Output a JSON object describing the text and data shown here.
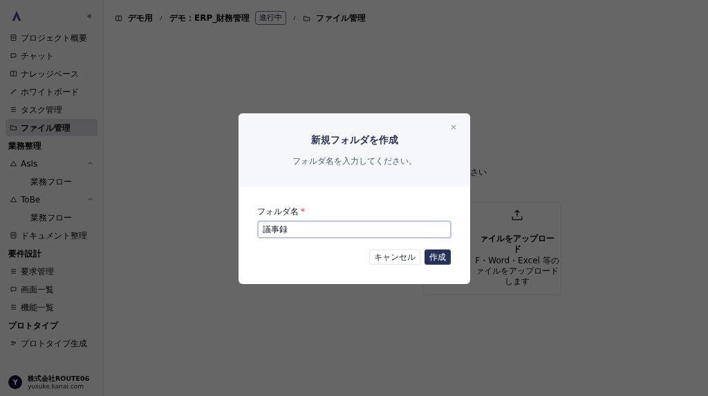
{
  "sidebar": {
    "collapse_icon": "«",
    "items": [
      {
        "kind": "item",
        "label": "プロジェクト概要",
        "selected": false
      },
      {
        "kind": "item",
        "label": "チャット",
        "selected": false
      },
      {
        "kind": "item",
        "label": "ナレッジベース",
        "selected": false
      },
      {
        "kind": "item",
        "label": "ホワイトボード",
        "selected": false
      },
      {
        "kind": "item",
        "label": "タスク管理",
        "selected": false
      },
      {
        "kind": "item",
        "label": "ファイル管理",
        "selected": true
      },
      {
        "kind": "section",
        "label": "業務整理"
      },
      {
        "kind": "group",
        "label": "AsIs",
        "expanded": true,
        "children": [
          {
            "label": "業務フロー"
          }
        ]
      },
      {
        "kind": "group",
        "label": "ToBe",
        "expanded": true,
        "children": [
          {
            "label": "業務フロー"
          }
        ]
      },
      {
        "kind": "item",
        "label": "ドキュメント整理",
        "selected": false
      },
      {
        "kind": "section",
        "label": "要件設計"
      },
      {
        "kind": "item",
        "label": "要求管理",
        "selected": false
      },
      {
        "kind": "item",
        "label": "画面一覧",
        "selected": false
      },
      {
        "kind": "item",
        "label": "機能一覧",
        "selected": false
      },
      {
        "kind": "section",
        "label": "プロトタイプ"
      },
      {
        "kind": "item",
        "label": "プロトタイプ生成",
        "selected": false
      }
    ],
    "user": {
      "name": "株式会社ROUTE06",
      "email": "yusuke.kanai.com",
      "initial": "Y"
    }
  },
  "breadcrumb": [
    {
      "label": "デモ用"
    },
    {
      "label": "デモ：ERP_財務管理",
      "badge": "進行中"
    },
    {
      "label": "ファイル管理"
    }
  ],
  "background": {
    "fragment": "さい",
    "upload_title": [
      "ァイルをアップロー",
      "ド"
    ],
    "upload_desc": [
      "F・Word・Excel 等の",
      "ァイルをアップロード",
      "します"
    ]
  },
  "dialog": {
    "title": "新規フォルダを作成",
    "subtitle": "フォルダ名を入力してください。",
    "field_label": "フォルダ名",
    "required_mark": "*",
    "value": "議事録",
    "buttons": [
      {
        "kind": "secondary",
        "label": "キャンセル"
      },
      {
        "kind": "primary",
        "label": "作成"
      }
    ]
  }
}
